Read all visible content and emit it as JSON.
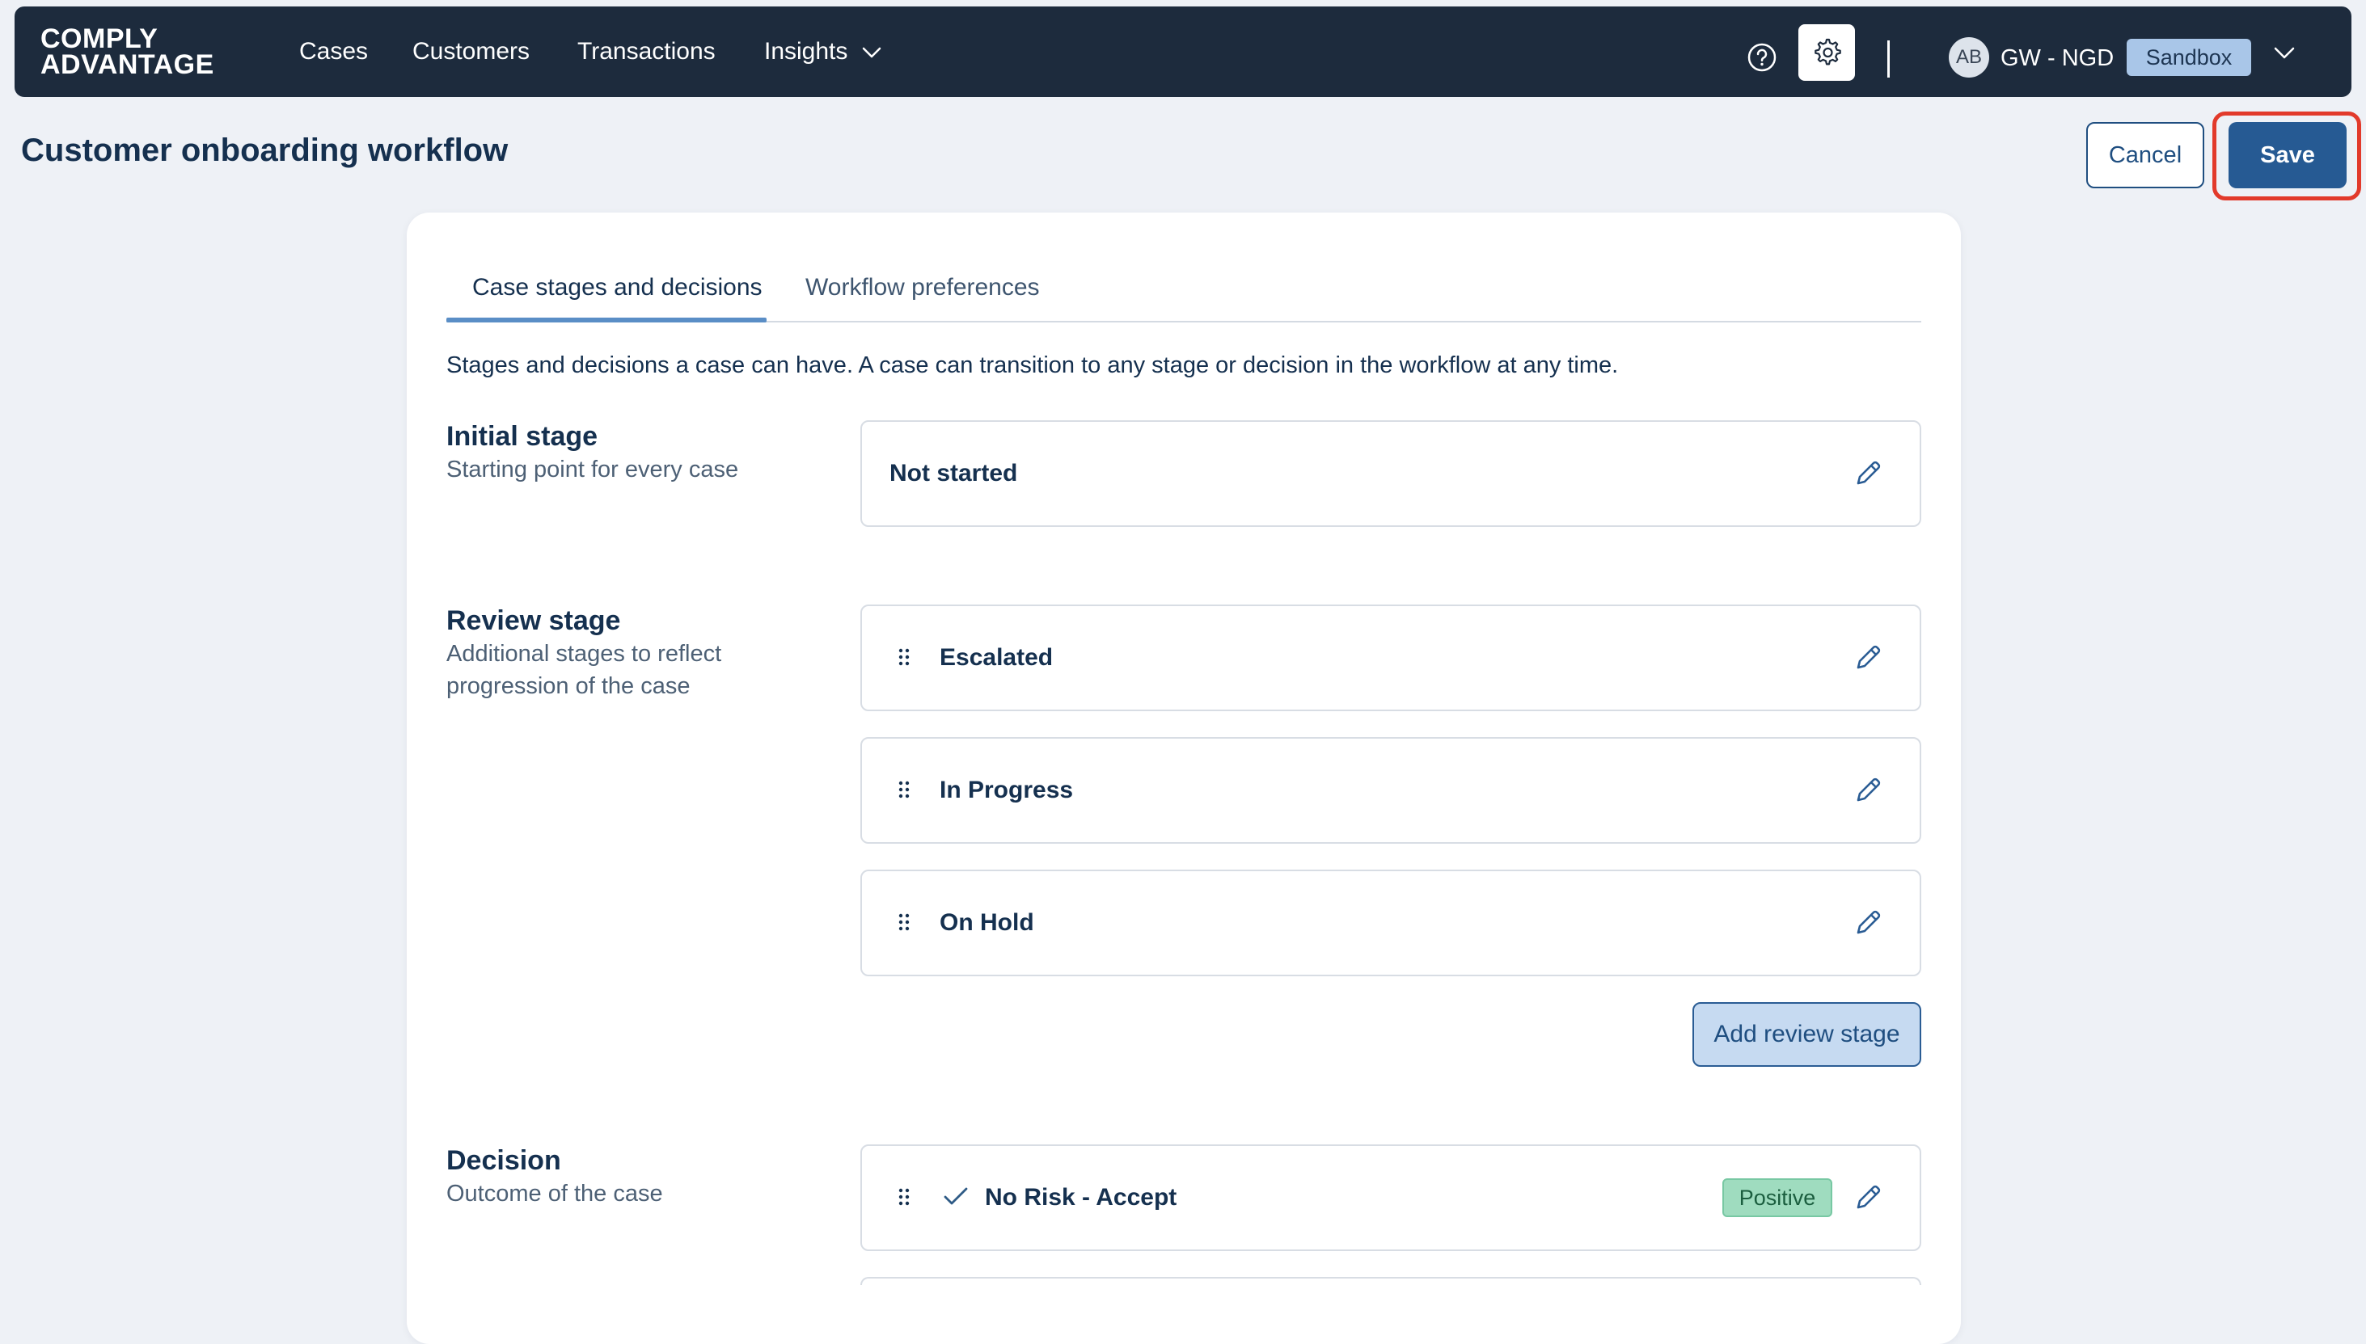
{
  "nav": {
    "logo_line1": "COMPLY",
    "logo_line2": "ADVANTAGE",
    "links": [
      "Cases",
      "Customers",
      "Transactions",
      "Insights"
    ],
    "help_icon": "question-circle-icon",
    "settings_icon": "gear-icon",
    "avatar_initials": "AB",
    "org_name": "GW - NGD",
    "env_badge": "Sandbox"
  },
  "header": {
    "title": "Customer onboarding workflow",
    "cancel_label": "Cancel",
    "save_label": "Save"
  },
  "tabs": [
    {
      "label": "Case stages and decisions",
      "active": true
    },
    {
      "label": "Workflow preferences",
      "active": false
    }
  ],
  "intro": "Stages and decisions a case can have. A case can transition to any stage or decision in the workflow at any time.",
  "initial_stage": {
    "title": "Initial stage",
    "subtitle": "Starting point for every case",
    "item": "Not started"
  },
  "review_stage": {
    "title": "Review stage",
    "subtitle": "Additional stages to reflect progression of the case",
    "items": [
      "Escalated",
      "In Progress",
      "On Hold"
    ],
    "add_label": "Add review stage"
  },
  "decision": {
    "title": "Decision",
    "subtitle": "Outcome of the case",
    "items": [
      {
        "label": "No Risk - Accept",
        "badge": "Positive"
      }
    ]
  },
  "colors": {
    "nav_bg": "#1d2b3d",
    "primary": "#265a93",
    "highlight": "#e23a2b",
    "positive_badge": "#9fdcbf"
  }
}
